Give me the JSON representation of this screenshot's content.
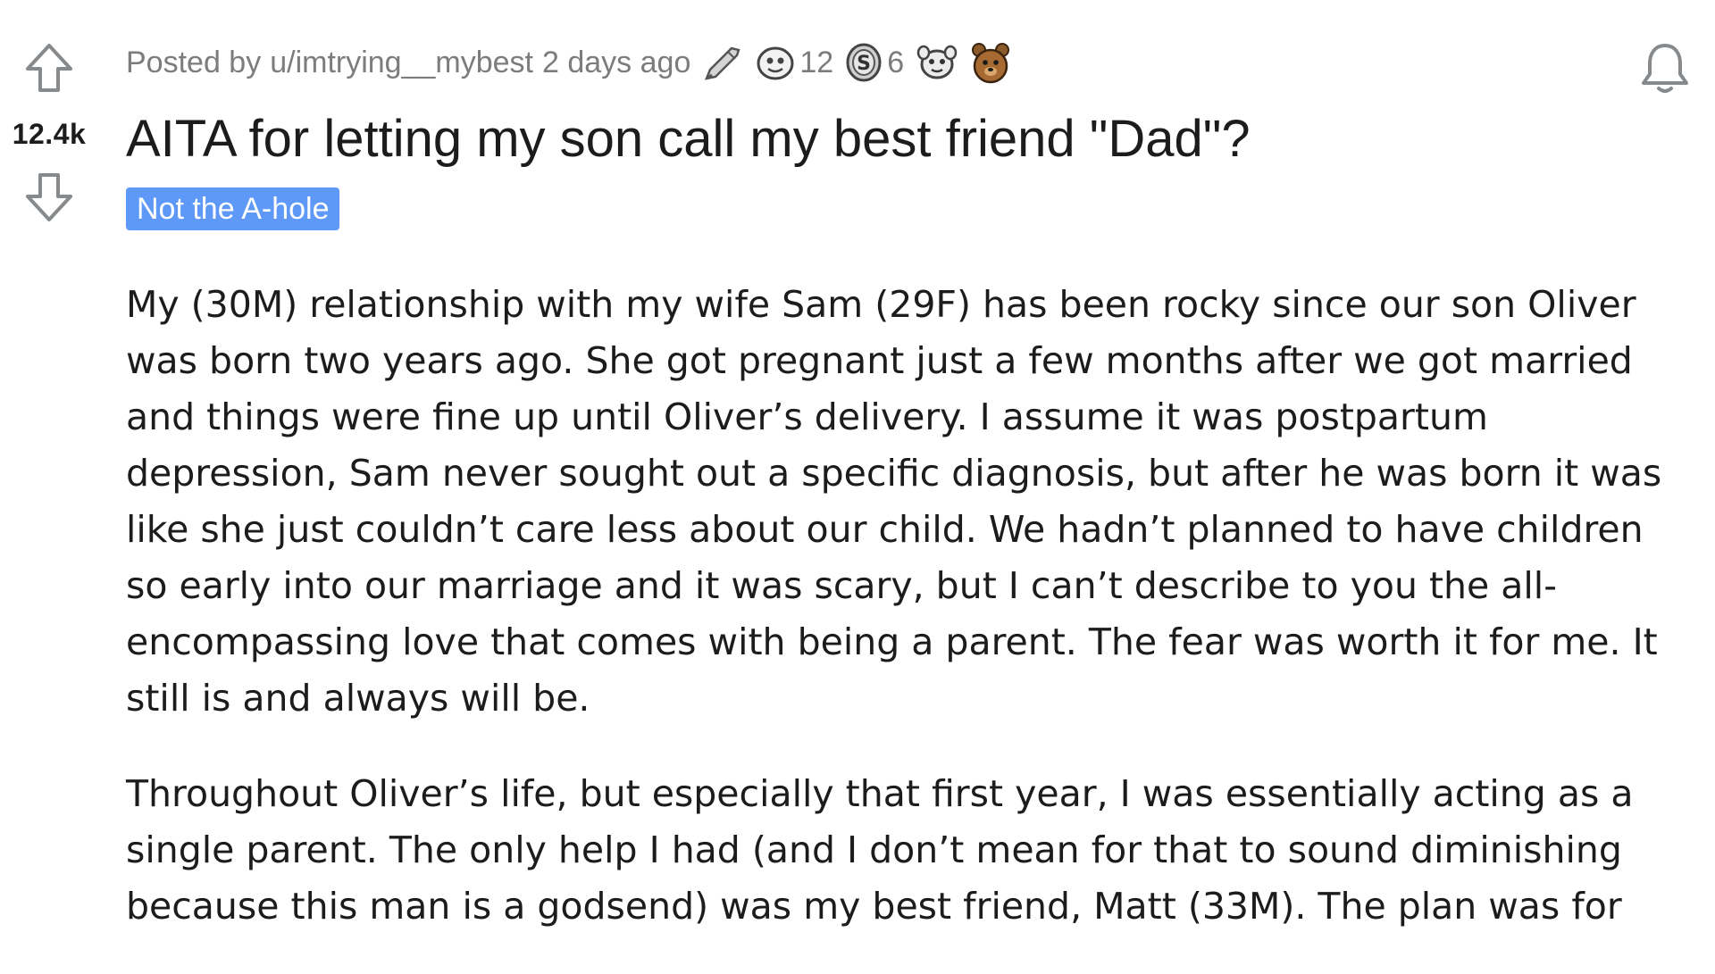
{
  "post": {
    "vote_count": "12.4k",
    "posted_by_prefix": "Posted by",
    "username": "u/imtrying__mybest",
    "time_ago": "2 days ago",
    "awards": [
      {
        "icon": "rocket-like-award-icon",
        "count": ""
      },
      {
        "icon": "helpful-award-icon",
        "count": "12"
      },
      {
        "icon": "silver-coin-award-icon",
        "count": "6"
      },
      {
        "icon": "wholesome-award-icon",
        "count": ""
      },
      {
        "icon": "bear-award-icon",
        "count": ""
      }
    ],
    "title": "AITA for letting my son call my best friend \"Dad\"?",
    "flair": "Not the A-hole",
    "flair_color": "#5f99f7",
    "paragraphs": [
      "My (30M) relationship with my wife Sam (29F) has been rocky since our son Oliver was born two years ago. She got pregnant just a few months after we got married and things were fine up until Oliver’s delivery. I assume it was postpartum depression, Sam never sought out a specific diagnosis, but after he was born it was like she just couldn’t care less about our child. We hadn’t planned to have children so early into our marriage and it was scary, but I can’t describe to you the all-encompassing love that comes with being a parent. The fear was worth it for me. It still is and always will be.",
      "Throughout Oliver’s life, but especially that first year, I was essentially acting as a single parent. The only help I had (and I don’t mean for that to sound diminishing because this man is a godsend) was my best friend, Matt (33M). The plan was for"
    ]
  }
}
